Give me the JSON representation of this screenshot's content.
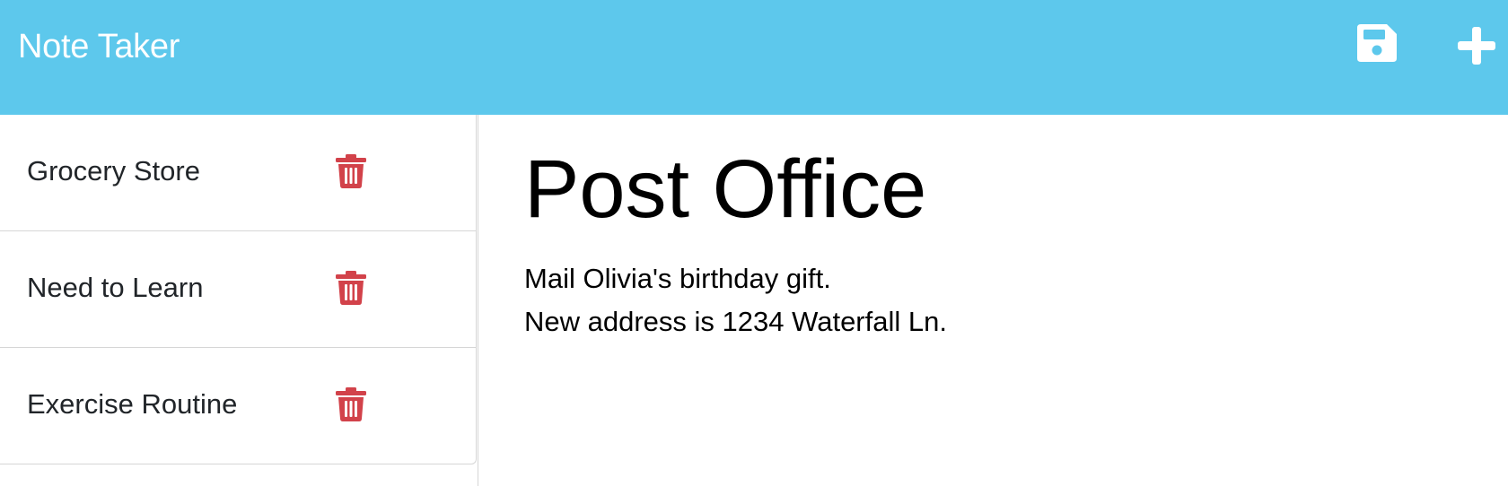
{
  "app": {
    "title": "Note Taker"
  },
  "toolbar": {
    "save_icon": "floppy-disk-icon",
    "new_icon": "plus-icon"
  },
  "sidebar": {
    "items": [
      {
        "label": "Grocery Store",
        "delete_icon": "trash-icon"
      },
      {
        "label": "Need to Learn",
        "delete_icon": "trash-icon"
      },
      {
        "label": "Exercise Routine",
        "delete_icon": "trash-icon"
      }
    ]
  },
  "note": {
    "title": "Post Office",
    "lines": [
      "Mail Olivia's birthday gift.",
      "New address is 1234 Waterfall Ln."
    ]
  },
  "colors": {
    "navbar": "#5dc8ec",
    "navbar_text": "#ffffff",
    "delete_icon": "#d2424a",
    "divider": "#d6d6d6"
  }
}
